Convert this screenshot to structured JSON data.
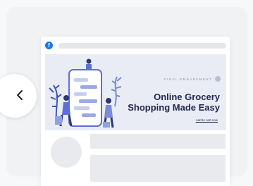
{
  "ad_preview": {
    "logo_letter": "f",
    "banner": {
      "brand_text": "FINAL EMBARKMENT",
      "headline_line1": "Online Grocery",
      "headline_line2": "Shopping Made Easy",
      "cta_text": "Add to cart now"
    }
  },
  "controls": {
    "prev_icon": "chevron-left-icon"
  },
  "colors": {
    "facebook_blue": "#1877f2",
    "headline": "#23294f",
    "banner_bg": "#e9ecf4",
    "illustration_blue": "#5b6fd6",
    "placeholder": "#e9eaed"
  }
}
